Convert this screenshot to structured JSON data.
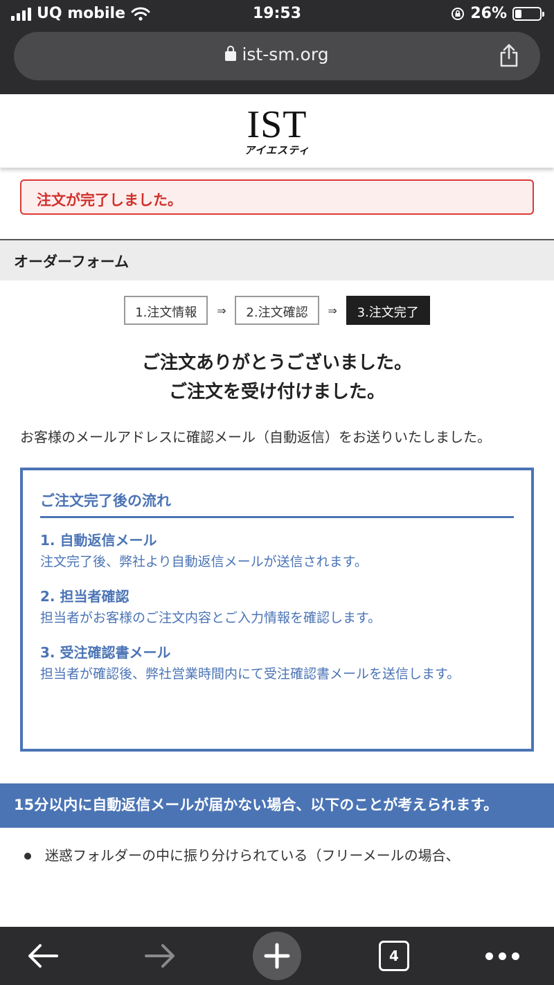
{
  "status_bar": {
    "carrier": "UQ mobile",
    "time": "19:53",
    "battery_percent": "26%"
  },
  "browser": {
    "url": "ist-sm.org",
    "tab_count": "4"
  },
  "header": {
    "logo_main": "IST",
    "logo_sub": "アイエスティ"
  },
  "alert": {
    "text": "注文が完了しました。"
  },
  "section": {
    "title": "オーダーフォーム"
  },
  "steps": [
    {
      "label": "1.注文情報"
    },
    {
      "label": "2.注文確認"
    },
    {
      "label": "3.注文完了"
    }
  ],
  "step_arrow": "⇒",
  "thanks": {
    "line1": "ご注文ありがとうございました。",
    "line2": "ご注文を受け付けました。"
  },
  "notice": "お客様のメールアドレスに確認メール（自動返信）をお送りいたしました。",
  "flow": {
    "title": "ご注文完了後の流れ",
    "items": [
      {
        "heading": "1. 自動返信メール",
        "description": "注文完了後、弊社より自動返信メールが送信されます。"
      },
      {
        "heading": "2. 担当者確認",
        "description": "担当者がお客様のご注文内容とご入力情報を確認します。"
      },
      {
        "heading": "3. 受注確認書メール",
        "description": "担当者が確認後、弊社営業時間内にて受注確認書メールを送信します。"
      }
    ]
  },
  "no_mail": {
    "heading": "15分以内に自動返信メールが届かない場合、以下のことが考えられます。",
    "items": [
      "迷惑フォルダーの中に振り分けられている（フリーメールの場合、"
    ]
  },
  "colors": {
    "accent_blue": "#4b74b5",
    "alert_red": "#d93a35",
    "chrome_dark": "#2c2c2e"
  }
}
